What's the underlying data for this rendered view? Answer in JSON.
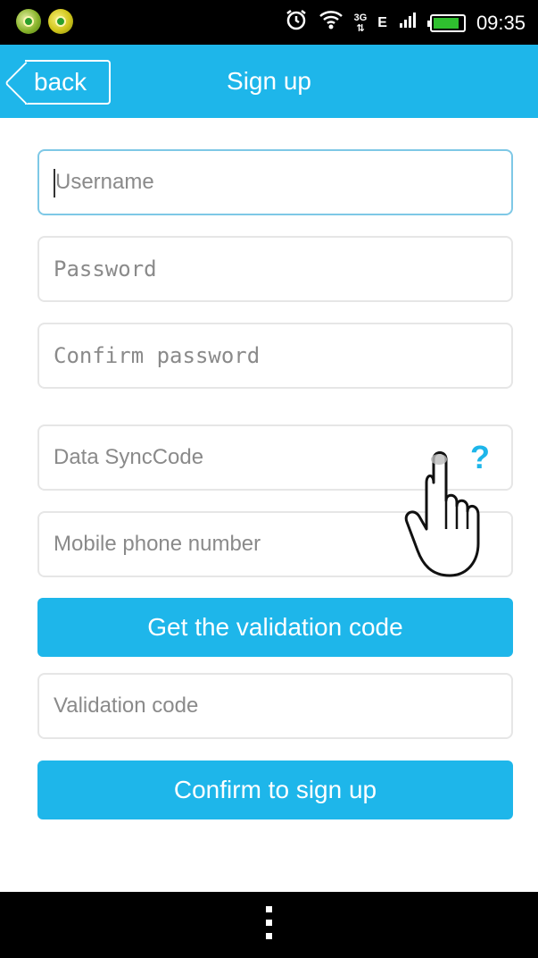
{
  "status_bar": {
    "time": "09:35",
    "network_type": "E",
    "signal_small_label_top": "3G",
    "signal_small_label_bottom": "",
    "icons": [
      "app-notification-icon",
      "app-notification-icon",
      "alarm-icon",
      "wifi-icon",
      "data-transfer-icon",
      "network-e-icon",
      "signal-icon",
      "battery-icon"
    ],
    "battery_level": 0.9
  },
  "header": {
    "back_label": "back",
    "title": "Sign up"
  },
  "form": {
    "username_placeholder": "Username",
    "password_placeholder": "Password",
    "confirm_password_placeholder": "Confirm password",
    "sync_code_placeholder": "Data SyncCode",
    "sync_code_help": "?",
    "phone_placeholder": "Mobile phone number",
    "get_code_label": "Get the validation code",
    "validation_code_placeholder": "Validation code",
    "confirm_signup_label": "Confirm to sign up"
  },
  "overlay": {
    "pointer_icon": "hand-pointer-icon"
  },
  "colors": {
    "accent": "#1eb6ea",
    "status_bar": "#000000",
    "field_border": "#e6e6e6",
    "placeholder": "#8a8a8a"
  }
}
